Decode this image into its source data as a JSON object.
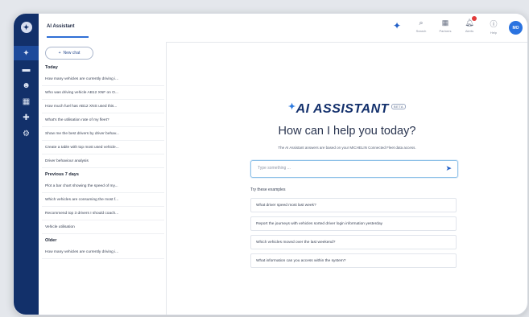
{
  "app": {
    "title": "AI Assistant"
  },
  "topbar": {
    "items": [
      {
        "icon": "search-icon",
        "label": "Search"
      },
      {
        "icon": "grid-icon",
        "label": "Partners"
      },
      {
        "icon": "bell-icon",
        "label": "Alerts"
      },
      {
        "icon": "help-icon",
        "label": "Help"
      }
    ],
    "avatar_initials": "MO"
  },
  "sidebar": {
    "new_chat_label": "New chat",
    "sections": [
      {
        "title": "Today",
        "items": [
          "How many vehicles are currently driving i...",
          "Who was driving vehicle AB12 XNF on O...",
          "How much fuel has AB12 XNS used this...",
          "What's the utilisation rate of my fleet?",
          "Show me the best drivers by driver behav...",
          "Create a table with top most used vehicle...",
          "Driver behaviour analysis"
        ]
      },
      {
        "title": "Previous 7 days",
        "items": [
          "Plot a bar chart showing the speed of my...",
          "Which vehicles are consuming the most f...",
          "Recommend top 3 drivers I should coach...",
          "Vehicle utilisation"
        ]
      },
      {
        "title": "Older",
        "items": [
          "How many vehicles are currently driving i..."
        ]
      }
    ]
  },
  "main": {
    "brand": "AI ASSISTANT",
    "beta": "BETA",
    "headline": "How can I help you today?",
    "subline": "The AI Assistant answers are based on your MICHELIN Connected Fleet data access.",
    "input_placeholder": "Type something ...",
    "examples_title": "Try these examples",
    "examples": [
      "What driver speed most last week?",
      "Report the journeys with vehicles sorted driver login information yesterday",
      "Which vehicles moved over the last weekend?",
      "What information can you access within the system?"
    ]
  },
  "colors": {
    "rail": "#12306a",
    "accent": "#2260c8",
    "brand": "#13306c"
  }
}
